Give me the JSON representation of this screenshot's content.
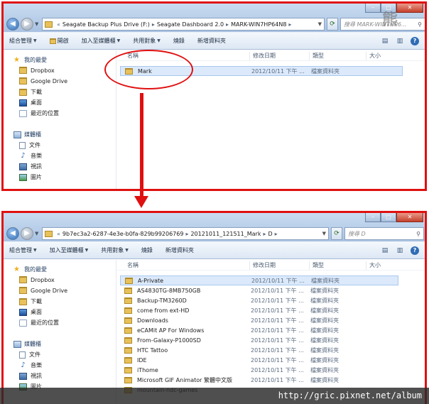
{
  "top": {
    "address": [
      "Seagate Backup Plus Drive (F:)",
      "Seagate Dashboard 2.0",
      "MARK-WIN7HP64N8"
    ],
    "address_lead": "«",
    "search_placeholder": "搜尋 MARK-WIN7HP6...",
    "toolbar": [
      "組合管理",
      "開啟",
      "加入至媒體櫃",
      "共用對象",
      "燒錄",
      "新增資料夾"
    ],
    "columns": [
      "名稱",
      "修改日期",
      "類型",
      "大小"
    ],
    "rows": [
      {
        "name": "Mark",
        "date": "2012/10/11 下午 ...",
        "type": "檔案資料夾"
      }
    ]
  },
  "bottom": {
    "address": [
      "9b7ec3a2-6287-4e3e-b0fa-829b99206769",
      "20121011_121511_Mark",
      "D"
    ],
    "address_lead": "«",
    "search_placeholder": "搜尋 D",
    "toolbar": [
      "組合管理",
      "加入至媒體櫃",
      "共用對象",
      "燒錄",
      "新增資料夾"
    ],
    "columns": [
      "名稱",
      "修改日期",
      "類型",
      "大小"
    ],
    "rows": [
      {
        "name": "A-Private",
        "date": "2012/10/11 下午 ...",
        "type": "檔案資料夾"
      },
      {
        "name": "AS4830TG-8MB750GB",
        "date": "2012/10/11 下午 ...",
        "type": "檔案資料夾"
      },
      {
        "name": "Backup-TM3260D",
        "date": "2012/10/11 下午 ...",
        "type": "檔案資料夾"
      },
      {
        "name": "come from ext-HD",
        "date": "2012/10/11 下午 ...",
        "type": "檔案資料夾"
      },
      {
        "name": "Downloads",
        "date": "2012/10/11 下午 ...",
        "type": "檔案資料夾"
      },
      {
        "name": "eCAMit AP For Windows",
        "date": "2012/10/11 下午 ...",
        "type": "檔案資料夾"
      },
      {
        "name": "From-Galaxy-P1000SD",
        "date": "2012/10/11 下午 ...",
        "type": "檔案資料夾"
      },
      {
        "name": "HTC Tattoo",
        "date": "2012/10/11 下午 ...",
        "type": "檔案資料夾"
      },
      {
        "name": "IDE",
        "date": "2012/10/11 下午 ...",
        "type": "檔案資料夾"
      },
      {
        "name": "iThome",
        "date": "2012/10/11 下午 ...",
        "type": "檔案資料夾"
      },
      {
        "name": "Microsoft GIF Animator 繁體中文版",
        "date": "2012/10/11 下午 ...",
        "type": "檔案資料夾"
      },
      {
        "name": "mountain-ndc-games",
        "date": "",
        "type": ""
      }
    ]
  },
  "sidebar": {
    "favorites": "我的最愛",
    "fav_items": [
      "Dropbox",
      "Google Drive",
      "下載",
      "桌面",
      "最近的位置"
    ],
    "libraries": "媒體櫃",
    "lib_items": [
      "文件",
      "音樂",
      "視訊",
      "圖片"
    ]
  },
  "watermark": "http://gric.pixnet.net/album",
  "logo_text": "熊",
  "colors": {
    "annotation": "#e01010",
    "selection": "#dbe9fb",
    "accent": "#2f6cb4"
  }
}
